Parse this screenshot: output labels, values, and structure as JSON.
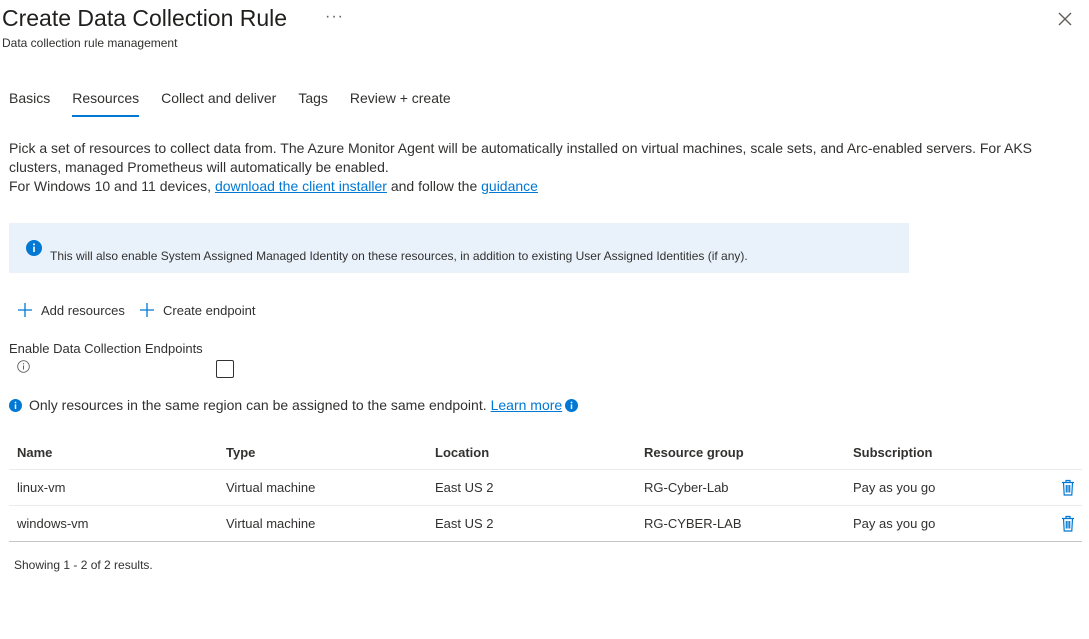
{
  "header": {
    "title": "Create Data Collection Rule",
    "subtitle": "Data collection rule management",
    "more_label": "···"
  },
  "tabs": [
    {
      "label": "Basics",
      "active": false
    },
    {
      "label": "Resources",
      "active": true
    },
    {
      "label": "Collect and deliver",
      "active": false
    },
    {
      "label": "Tags",
      "active": false
    },
    {
      "label": "Review + create",
      "active": false
    }
  ],
  "description": {
    "line1": "Pick a set of resources to collect data from. The Azure Monitor Agent will be automatically installed on virtual machines, scale sets, and Arc-enabled servers. For AKS clusters, managed Prometheus will automatically be enabled.",
    "line2_prefix": "For Windows 10 and 11 devices, ",
    "installer_link": "download the client installer",
    "line2_middle": " and follow the ",
    "guidance_link": "guidance"
  },
  "info_bar": {
    "text": "This will also enable System Assigned Managed Identity on these resources, in addition to existing User Assigned Identities (if any)."
  },
  "commands": {
    "add_resources": "Add resources",
    "create_endpoint": "Create endpoint"
  },
  "endpoints": {
    "label": "Enable Data Collection Endpoints",
    "checked": false
  },
  "region_note": {
    "text": "Only resources in the same region can be assigned to the same endpoint.",
    "link": "Learn more"
  },
  "table": {
    "columns": [
      "Name",
      "Type",
      "Location",
      "Resource group",
      "Subscription"
    ],
    "rows": [
      {
        "name": "linux-vm",
        "type": "Virtual machine",
        "location": "East US 2",
        "resource_group": "RG-Cyber-Lab",
        "subscription": "Pay as you go"
      },
      {
        "name": "windows-vm",
        "type": "Virtual machine",
        "location": "East US 2",
        "resource_group": "RG-CYBER-LAB",
        "subscription": "Pay as you go"
      }
    ]
  },
  "footer": {
    "showing": "Showing 1 - 2 of 2 results."
  },
  "colors": {
    "accent": "#0078d4",
    "info_bg": "#e9f2fb"
  },
  "icons": {
    "close": "close-icon",
    "info": "info-icon",
    "add": "plus-icon",
    "delete": "trash-icon"
  }
}
